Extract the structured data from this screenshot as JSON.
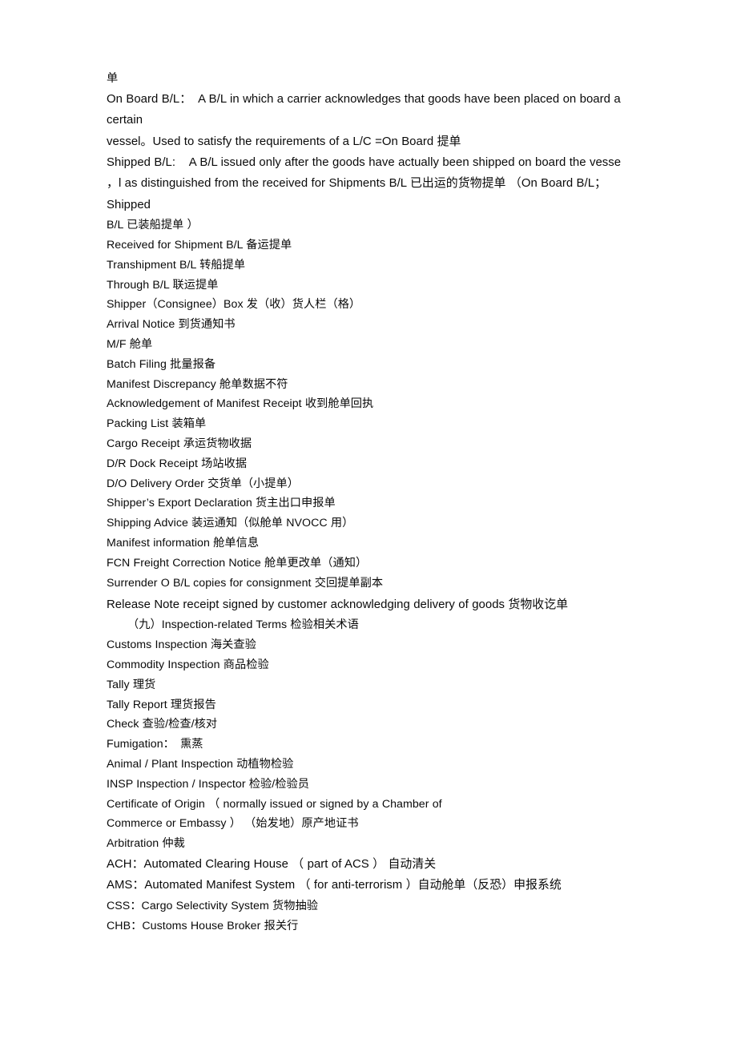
{
  "document": {
    "background_color": "#ffffff",
    "text_color": "#0a0a0a",
    "lines": [
      {
        "id": "l01",
        "text": "单"
      },
      {
        "id": "l02",
        "text": "On Board B/L：  A B/L in which a carrier acknowledges that goods have been placed on board a"
      },
      {
        "id": "l03",
        "text": "certain"
      },
      {
        "id": "l04",
        "text": "vessel。Used to satisfy the requirements of a L/C =On Board 提单"
      },
      {
        "id": "l05",
        "text": "Shipped B/L:    A B/L issued only after the goods have actually been shipped on board the vesse"
      },
      {
        "id": "l06",
        "text": "，l as distinguished from the received for Shipments B/L 已出运的货物提单 （On Board B/L；"
      },
      {
        "id": "l07",
        "text": "Shipped"
      },
      {
        "id": "l08",
        "text": "B/L 已装船提单 ）"
      },
      {
        "id": "l09",
        "text": "Received for Shipment B/L 备运提单"
      },
      {
        "id": "l10",
        "text": "Transhipment B/L 转船提单"
      },
      {
        "id": "l11",
        "text": "Through B/L 联运提单"
      },
      {
        "id": "l12",
        "text": "Shipper（Consignee）Box 发（收）货人栏（格）"
      },
      {
        "id": "l13",
        "text": "Arrival Notice 到货通知书"
      },
      {
        "id": "l14",
        "text": "M/F 舱单"
      },
      {
        "id": "l15",
        "text": "Batch Filing 批量报备"
      },
      {
        "id": "l16",
        "text": "Manifest Discrepancy 舱单数据不符"
      },
      {
        "id": "l17",
        "text": "Acknowledgement of Manifest Receipt 收到舱单回执"
      },
      {
        "id": "l18",
        "text": "Packing List 装箱单"
      },
      {
        "id": "l19",
        "text": "Cargo Receipt 承运货物收据"
      },
      {
        "id": "l20",
        "text": "D/R Dock Receipt 场站收据"
      },
      {
        "id": "l21",
        "text": "D/O Delivery Order 交货单（小提单）"
      },
      {
        "id": "l22",
        "text": "Shipper’s Export Declaration 货主出口申报单"
      },
      {
        "id": "l23",
        "text": "Shipping Advice 装运通知（似舱单 NVOCC 用）"
      },
      {
        "id": "l24",
        "text": "Manifest information 舱单信息"
      },
      {
        "id": "l25",
        "text": "FCN Freight Correction Notice 舱单更改单（通知）"
      },
      {
        "id": "l26",
        "text": "Surrender O B/L copies for consignment 交回提单副本"
      },
      {
        "id": "l27",
        "text": "Release Note receipt signed by customer acknowledging delivery of goods 货物收讫单"
      },
      {
        "id": "l28",
        "text": "（九）Inspection-related Terms 检验相关术语"
      },
      {
        "id": "l29",
        "text": "Customs Inspection 海关查验"
      },
      {
        "id": "l30",
        "text": "Commodity Inspection 商品检验"
      },
      {
        "id": "l31",
        "text": "Tally 理货"
      },
      {
        "id": "l32",
        "text": "Tally Report 理货报告"
      },
      {
        "id": "l33",
        "text": "Check 查验/检查/核对"
      },
      {
        "id": "l34",
        "text": "Fumigation：　熏蒸"
      },
      {
        "id": "l35",
        "text": "Animal / Plant Inspection 动植物检验"
      },
      {
        "id": "l36",
        "text": "INSP Inspection / Inspector 检验/检验员"
      },
      {
        "id": "l37",
        "text": "Certificate of Origin （ normally issued or signed by a Chamber of"
      },
      {
        "id": "l38",
        "text": "Commerce or Embassy ） （始发地）原产地证书"
      },
      {
        "id": "l39",
        "text": "Arbitration 仲裁"
      },
      {
        "id": "l40",
        "text": "ACH：Automated Clearing House （ part of ACS ） 自动清关"
      },
      {
        "id": "l41",
        "text": "AMS：Automated Manifest System （ for anti-terrorism ）自动舱单（反恐）申报系统"
      },
      {
        "id": "l42",
        "text": "CSS：Cargo Selectivity System 货物抽验"
      },
      {
        "id": "l43",
        "text": "CHB：Customs House Broker 报关行"
      }
    ]
  }
}
